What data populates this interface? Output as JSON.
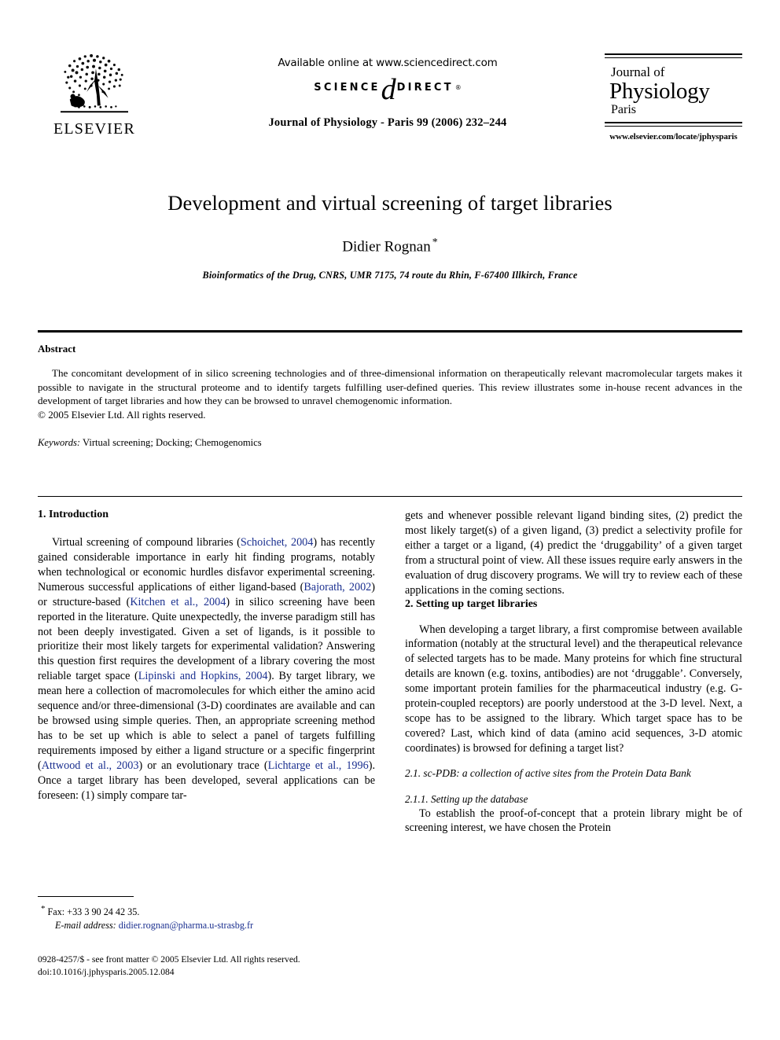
{
  "header": {
    "publisher_logo_name": "ELSEVIER",
    "available_online": "Available online at www.sciencedirect.com",
    "sciencedirect": {
      "word_left": "SCIENCE",
      "at_glyph": "d",
      "word_right": "DIRECT",
      "trademark": "®"
    },
    "journal_reference": "Journal of Physiology - Paris 99 (2006) 232–244",
    "journal_logo": {
      "line1": "Journal of",
      "line2": "Physiology",
      "line3": "Paris"
    },
    "journal_url": "www.elsevier.com/locate/jphysparis"
  },
  "title_block": {
    "title": "Development and virtual screening of target libraries",
    "author": "Didier Rognan",
    "author_marker": "*",
    "affiliation": "Bioinformatics of the Drug, CNRS, UMR 7175, 74 route du Rhin, F-67400 Illkirch, France"
  },
  "abstract": {
    "heading": "Abstract",
    "text": "The concomitant development of in silico screening technologies and of three-dimensional information on therapeutically relevant macromolecular targets makes it possible to navigate in the structural proteome and to identify targets fulfilling user-defined queries. This review illustrates some in-house recent advances in the development of target libraries and how they can be browsed to unravel chemogenomic information.",
    "copyright": "© 2005 Elsevier Ltd. All rights reserved.",
    "keywords_label": "Keywords:",
    "keywords_value": "Virtual screening; Docking; Chemogenomics"
  },
  "body": {
    "left_column": {
      "section_heading": "1. Introduction",
      "paragraph_segments": [
        {
          "type": "text",
          "value": "Virtual screening of compound libraries ("
        },
        {
          "type": "cite",
          "value": "Schoichet, 2004"
        },
        {
          "type": "text",
          "value": ") has recently gained considerable importance in early hit finding programs, notably when technological or economic hurdles disfavor experimental screening. Numerous successful applications of either ligand-based ("
        },
        {
          "type": "cite",
          "value": "Bajorath, 2002"
        },
        {
          "type": "text",
          "value": ") or structure-based ("
        },
        {
          "type": "cite",
          "value": "Kitchen et al., 2004"
        },
        {
          "type": "text",
          "value": ") in silico screening have been reported in the literature. Quite unexpectedly, the inverse paradigm still has not been deeply investigated. Given a set of ligands, is it possible to prioritize their most likely targets for experimental validation? Answering this question first requires the development of a library covering the most reliable target space ("
        },
        {
          "type": "cite",
          "value": "Lipinski and Hopkins, 2004"
        },
        {
          "type": "text",
          "value": "). By target library, we mean here a collection of macromolecules for which either the amino acid sequence and/or three-dimensional (3-D) coordinates are available and can be browsed using simple queries. Then, an appropriate screening method has to be set up which is able to select a panel of targets fulfilling requirements imposed by either a ligand structure or a specific fingerprint ("
        },
        {
          "type": "cite",
          "value": "Attwood et al., 2003"
        },
        {
          "type": "text",
          "value": ") or an evolutionary trace ("
        },
        {
          "type": "cite",
          "value": "Lichtarge et al., 1996"
        },
        {
          "type": "text",
          "value": "). Once a target library has been developed, several applications can be foreseen: (1) simply compare tar-"
        }
      ]
    },
    "right_column": {
      "continuation_paragraph": "gets and whenever possible relevant ligand binding sites, (2) predict the most likely target(s) of a given ligand, (3) predict a selectivity profile for either a target or a ligand, (4) predict the ‘druggability’ of a given target from a structural point of view. All these issues require early answers in the evaluation of drug discovery programs. We will try to review each of these applications in the coming sections.",
      "section_heading": "2. Setting up target libraries",
      "paragraph_2": "When developing a target library, a first compromise between available information (notably at the structural level) and the therapeutical relevance of selected targets has to be made. Many proteins for which fine structural details are known (e.g. toxins, antibodies) are not ‘druggable’. Conversely, some important protein families for the pharmaceutical industry (e.g. G-protein-coupled receptors) are poorly understood at the 3-D level. Next, a scope has to be assigned to the library. Which target space has to be covered? Last, which kind of data (amino acid sequences, 3-D atomic coordinates) is browsed for defining a target list?",
      "subsection_heading": "2.1. sc-PDB: a collection of active sites from the Protein Data Bank",
      "subsubsection_heading": "2.1.1. Setting up the database",
      "paragraph_3": "To establish the proof-of-concept that a protein library might be of screening interest, we have chosen the Protein"
    }
  },
  "footnote": {
    "marker": "*",
    "fax": "Fax: +33 3 90 24 42 35.",
    "email_label": "E-mail address:",
    "email_value": "didier.rognan@pharma.u-strasbg.fr"
  },
  "page_footer": {
    "front_matter": "0928-4257/$ - see front matter © 2005 Elsevier Ltd. All rights reserved.",
    "doi": "doi:10.1016/j.jphysparis.2005.12.084"
  },
  "colors": {
    "link": "#1a2f8f",
    "text": "#000000",
    "background": "#ffffff"
  }
}
